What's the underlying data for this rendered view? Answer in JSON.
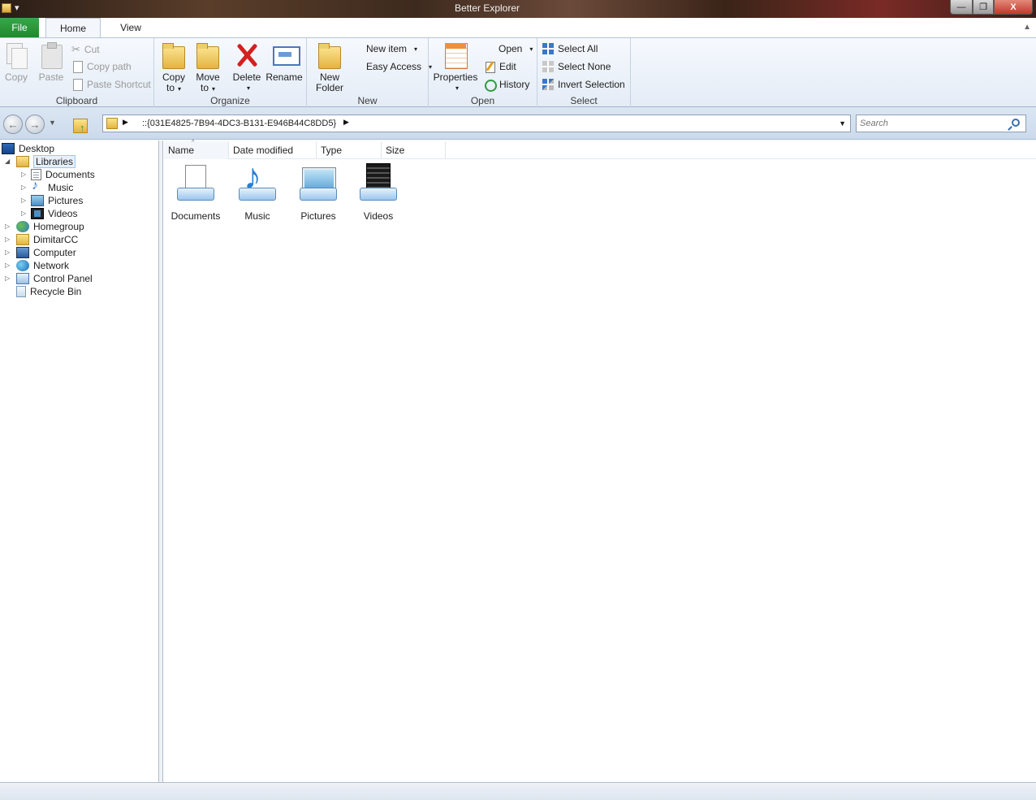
{
  "window": {
    "title": "Better Explorer",
    "min_glyph": "—",
    "max_glyph": "❐",
    "close_glyph": "X",
    "qat_glyph": "▾"
  },
  "tabs": {
    "file": "File",
    "home": "Home",
    "view": "View",
    "collapse_glyph": "▲"
  },
  "ribbon": {
    "clipboard": {
      "label": "Clipboard",
      "copy": "Copy",
      "paste": "Paste",
      "cut": "Cut",
      "copy_path": "Copy path",
      "paste_shortcut": "Paste Shortcut"
    },
    "organize": {
      "label": "Organize",
      "copy_to": "Copy",
      "copy_to_2": "to",
      "move_to": "Move",
      "move_to_2": "to",
      "delete": "Delete",
      "rename": "Rename"
    },
    "new": {
      "label": "New",
      "new_folder": "New",
      "new_folder_2": "Folder",
      "new_item": "New item",
      "easy_access": "Easy Access"
    },
    "open": {
      "label": "Open",
      "properties": "Properties",
      "open": "Open",
      "edit": "Edit",
      "history": "History"
    },
    "select": {
      "label": "Select",
      "select_all": "Select All",
      "select_none": "Select None",
      "invert_selection": "Invert Selection"
    }
  },
  "navbar": {
    "back_glyph": "←",
    "forward_glyph": "→",
    "history_glyph": "▼",
    "address": "::{031E4825-7B94-4DC3-B131-E946B44C8DD5}",
    "address_arrow": "▶",
    "address_drop": "▼",
    "search_placeholder": "Search"
  },
  "tree": {
    "items": [
      {
        "label": "Desktop",
        "icon": "desktop-icon"
      },
      {
        "label": "Libraries",
        "icon": "libraries-icon"
      },
      {
        "label": "Documents",
        "icon": "documents-icon"
      },
      {
        "label": "Music",
        "icon": "music-icon"
      },
      {
        "label": "Pictures",
        "icon": "pictures-icon"
      },
      {
        "label": "Videos",
        "icon": "videos-icon"
      },
      {
        "label": "Homegroup",
        "icon": "homegroup-icon"
      },
      {
        "label": "DimitarCC",
        "icon": "user-folder-icon"
      },
      {
        "label": "Computer",
        "icon": "computer-icon"
      },
      {
        "label": "Network",
        "icon": "network-icon"
      },
      {
        "label": "Control Panel",
        "icon": "control-panel-icon"
      },
      {
        "label": "Recycle Bin",
        "icon": "recycle-bin-icon"
      }
    ],
    "expand_glyph": "▷",
    "expanded_glyph": "◢"
  },
  "content": {
    "columns": [
      "Name",
      "Date modified",
      "Type",
      "Size"
    ],
    "sort_glyph": "^",
    "items": [
      {
        "label": "Documents",
        "icon": "documents-library-icon"
      },
      {
        "label": "Music",
        "icon": "music-library-icon"
      },
      {
        "label": "Pictures",
        "icon": "pictures-library-icon"
      },
      {
        "label": "Videos",
        "icon": "videos-library-icon"
      }
    ]
  }
}
